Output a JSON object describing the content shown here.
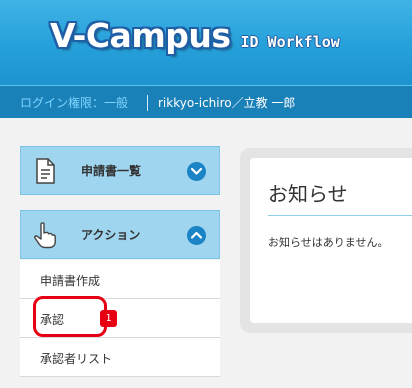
{
  "header": {
    "logo_main": "V-Campus",
    "logo_sub": "ID Workflow"
  },
  "userbar": {
    "permission": "ログイン権限：一般",
    "user": "rikkyo-ichiro／立教 一郎"
  },
  "sidebar": {
    "sections": [
      {
        "title": "申請書一覧",
        "icon": "document-icon",
        "toggle": "chevron-down"
      },
      {
        "title": "アクション",
        "icon": "pointing-hand-icon",
        "toggle": "chevron-up"
      }
    ],
    "actions": [
      {
        "label": "申請書作成"
      },
      {
        "label": "承認",
        "badge": "1"
      },
      {
        "label": "承認者リスト"
      }
    ]
  },
  "notice": {
    "title": "お知らせ",
    "message": "お知らせはありません。"
  },
  "colors": {
    "header_blue": "#26a0da",
    "userbar_blue": "#1a80b8",
    "sidebar_header": "#9fd5ef",
    "badge_red": "#e60012"
  }
}
